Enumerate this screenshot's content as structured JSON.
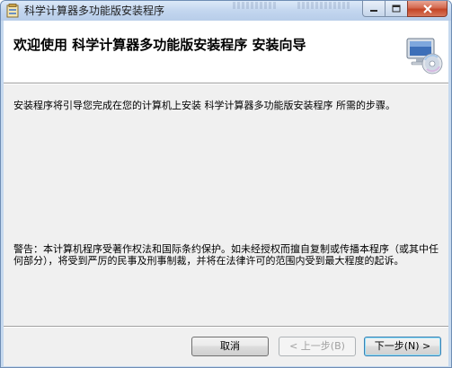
{
  "window": {
    "title": "科学计算器多功能版安装程序",
    "accent_color": "#c6d9ef",
    "controls": {
      "minimize_icon": "minimize-icon",
      "maximize_icon": "maximize-icon",
      "close_icon": "close-icon"
    }
  },
  "banner": {
    "title": "欢迎使用 科学计算器多功能版安装程序 安装向导",
    "icon": "computer-cd-icon"
  },
  "body": {
    "intro": "安装程序将引导您完成在您的计算机上安装 科学计算器多功能版安装程序 所需的步骤。",
    "warning": "警告：本计算机程序受著作权法和国际条约保护。如未经授权而擅自复制或传播本程序（或其中任何部分），将受到严厉的民事及刑事制裁，并将在法律许可的范围内受到最大程度的起诉。"
  },
  "buttons": {
    "cancel": "取消",
    "back": "< 上一步(B)",
    "next": "下一步(N) >"
  }
}
